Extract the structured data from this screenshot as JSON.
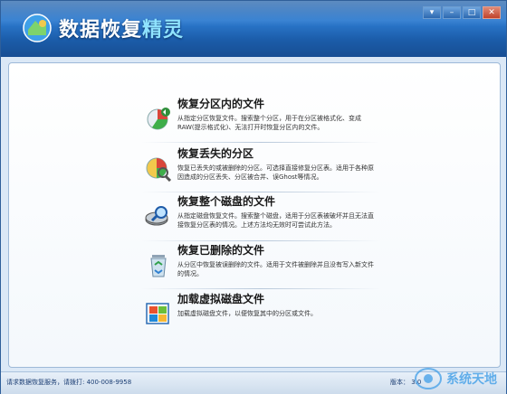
{
  "window": {
    "title": "数据恢复精灵",
    "title_main": "数据恢复",
    "title_accent": "精灵",
    "buttons": {
      "menu": "▾",
      "minimize": "–",
      "maximize": "□",
      "close": "✕"
    }
  },
  "menu": {
    "items": [
      {
        "icon": "partition-recover-icon",
        "title": "恢复分区内的文件",
        "desc": "从指定分区恢复文件。搜索整个分区，用于在分区被格式化、变成RAW(提示格式化)、无法打开时恢复分区内的文件。"
      },
      {
        "icon": "lost-partition-icon",
        "title": "恢复丢失的分区",
        "desc": "恢复已丢失的或被删除的分区。可选择直接修复分区表。适用于各种原因造成的分区丢失、分区被合并、误Ghost等情况。"
      },
      {
        "icon": "disk-recover-icon",
        "title": "恢复整个磁盘的文件",
        "desc": "从指定磁盘恢复文件。搜索整个磁盘，适用于分区表被破坏并且无法直接恢复分区表的情况。上述方法均无效时可尝试此方法。"
      },
      {
        "icon": "recycle-bin-icon",
        "title": "恢复已删除的文件",
        "desc": "从分区中恢复被误删除的文件。适用于文件被删除并且没有写入新文件的情况。"
      },
      {
        "icon": "virtual-disk-icon",
        "title": "加载虚拟磁盘文件",
        "desc": "加载虚拟磁盘文件，以便恢复其中的分区或文件。"
      }
    ]
  },
  "status": {
    "left": "请求数据恢复服务，请拨打: 400-008-9958",
    "version": "版本： 3.0"
  },
  "watermark": {
    "text": "系统天地"
  },
  "colors": {
    "titlebar": "#1f5fa8",
    "accent": "#8fe3ff",
    "status_text": "#1a3d73"
  }
}
